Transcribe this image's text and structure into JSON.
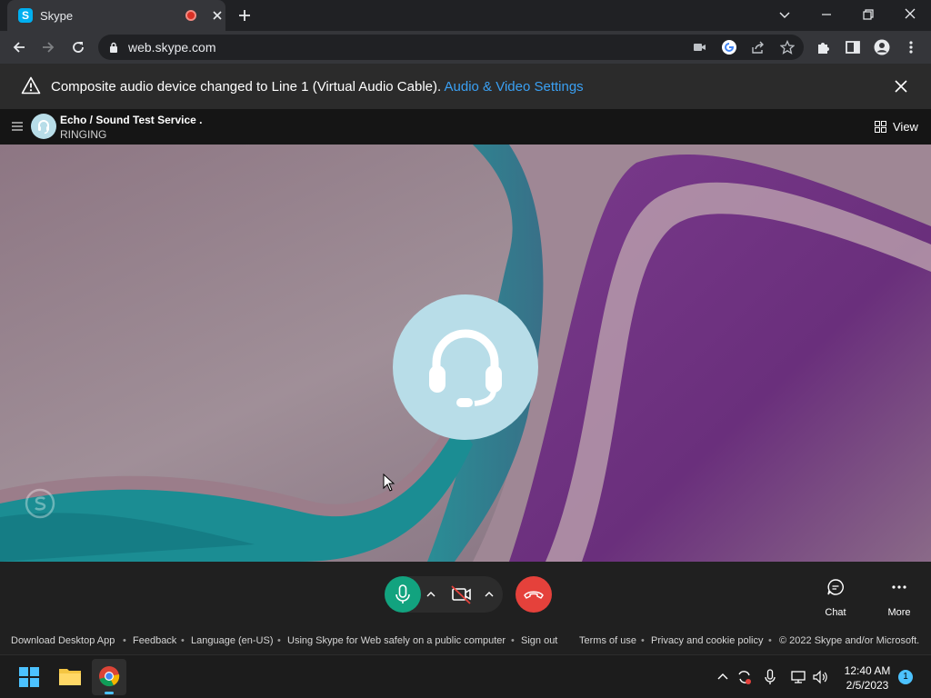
{
  "browser": {
    "tab": {
      "favicon_letter": "S",
      "title": "Skype"
    },
    "url": "web.skype.com"
  },
  "notification": {
    "message": "Composite audio device changed to Line 1 (Virtual Audio Cable).",
    "link_text": "Audio & Video Settings",
    "link_color": "#3aa0f3"
  },
  "call": {
    "contact_name": "Echo / Sound Test Service .",
    "status": "RINGING",
    "view_label": "View",
    "avatar_color": "#b8dde8"
  },
  "controls": {
    "chat_label": "Chat",
    "more_label": "More",
    "mic_color": "#12a37f",
    "hangup_color": "#e5413b"
  },
  "footer": {
    "download": "Download Desktop App",
    "feedback": "Feedback",
    "language": "Language (en-US)",
    "public_computer": "Using Skype for Web safely on a public computer",
    "sign_out": "Sign out",
    "terms": "Terms of use",
    "privacy": "Privacy and cookie policy",
    "copyright": "© 2022 Skype and/or Microsoft."
  },
  "taskbar": {
    "time": "12:40 AM",
    "date": "2/5/2023",
    "notification_count": "1"
  }
}
